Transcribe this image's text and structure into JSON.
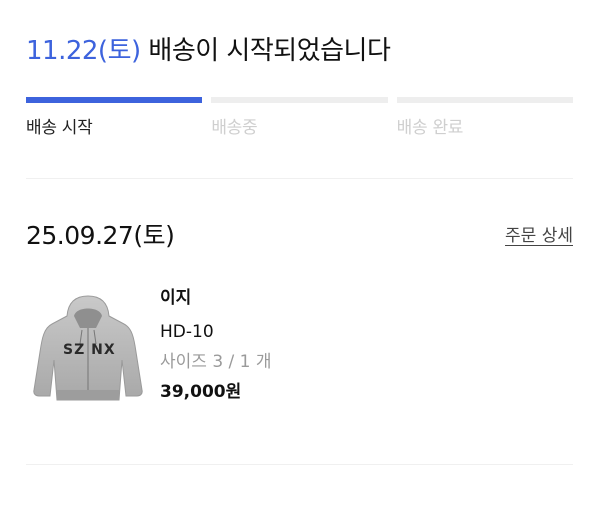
{
  "header": {
    "date": "11.22(토)",
    "message": "배송이 시작되었습니다"
  },
  "progress": {
    "steps": [
      {
        "label": "배송 시작",
        "active": true
      },
      {
        "label": "배송중",
        "active": false
      },
      {
        "label": "배송 완료",
        "active": false
      }
    ],
    "current_step": 1
  },
  "order": {
    "date": "25.09.27(토)",
    "detail_link": "주문 상세",
    "item": {
      "brand": "이지",
      "model": "HD-10",
      "size_qty": "사이즈 3 / 1 개",
      "price": "39,000원",
      "image_print": "SZ NX"
    }
  },
  "colors": {
    "accent": "#3d63dd",
    "inactive": "#cfcfcf"
  }
}
